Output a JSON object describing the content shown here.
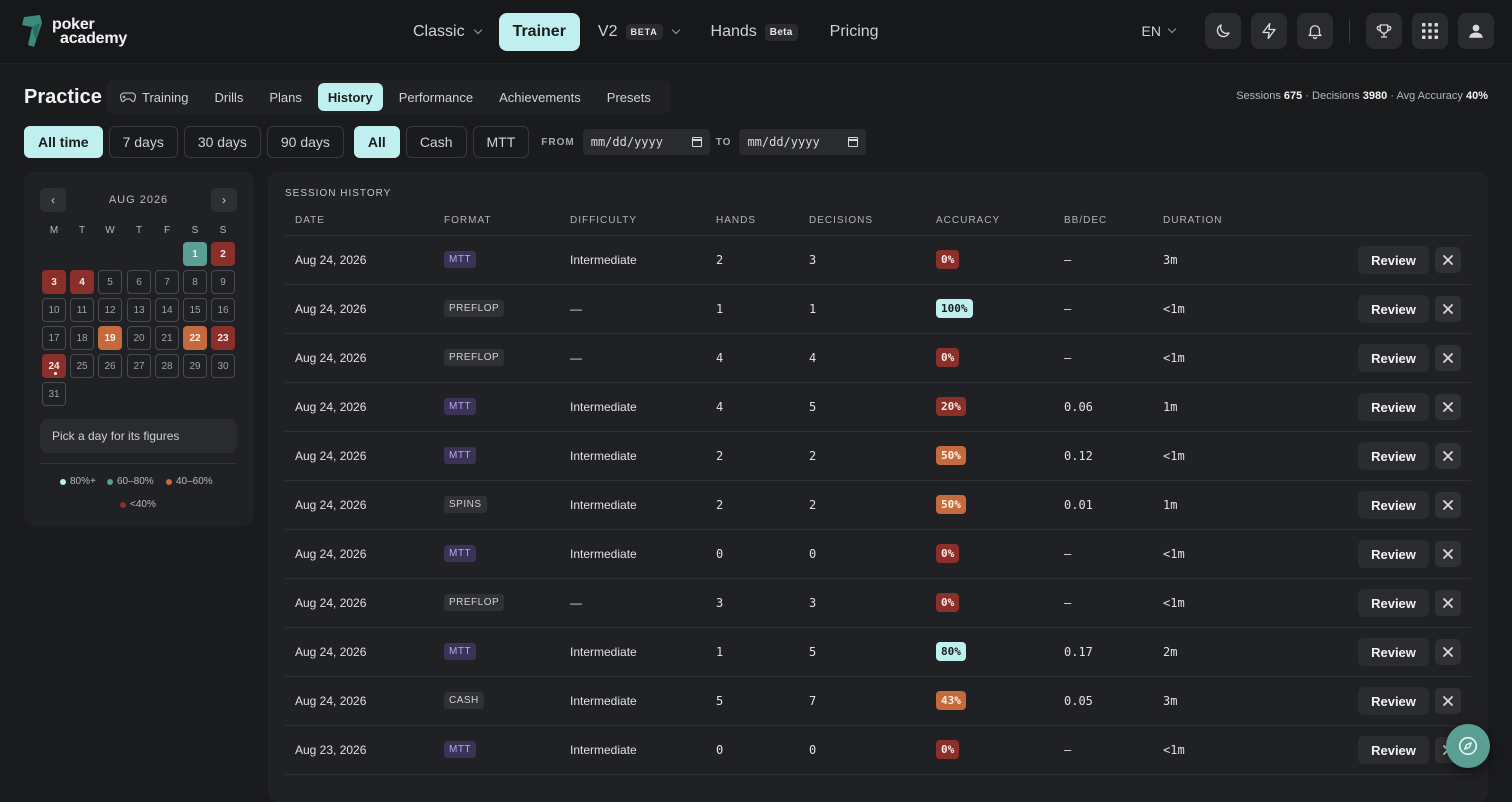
{
  "brand": {
    "line1": "poker",
    "line2": "academy"
  },
  "nav": {
    "classic": "Classic",
    "trainer": "Trainer",
    "v2": "V2",
    "v2_tag": "BETA",
    "hands": "Hands",
    "hands_tag": "Beta",
    "pricing": "Pricing"
  },
  "header_right": {
    "lang": "EN",
    "icons": [
      "moon-icon",
      "lightning-icon",
      "bell-icon",
      "trophy-icon",
      "grid-icon",
      "user-icon"
    ]
  },
  "practice": {
    "title": "Practice",
    "tabs": [
      "Training",
      "Drills",
      "Plans",
      "History",
      "Performance",
      "Achievements",
      "Presets"
    ],
    "active_tab": "History"
  },
  "stats": {
    "sessions_label": "Sessions",
    "sessions_value": "675",
    "decisions_label": "· Decisions",
    "decisions_value": "3980",
    "accuracy_label": "· Avg Accuracy",
    "accuracy_value": "40%"
  },
  "filters": {
    "ranges": [
      "All time",
      "7 days",
      "30 days",
      "90 days"
    ],
    "active_range": "All time",
    "formats": [
      "All",
      "Cash",
      "MTT"
    ],
    "active_format": "All",
    "from_label": "FROM",
    "to_label": "TO",
    "from_placeholder": "mm/dd/yyyy",
    "to_placeholder": "mm/dd/yyyy"
  },
  "calendar": {
    "month": "AUG 2026",
    "prev": "‹",
    "next": "›",
    "weekdays": [
      "M",
      "T",
      "W",
      "T",
      "F",
      "S",
      "S"
    ],
    "days": [
      {
        "d": "1",
        "s": "green"
      },
      {
        "d": "2",
        "s": "red"
      },
      {
        "d": "3",
        "s": "red"
      },
      {
        "d": "4",
        "s": "red"
      },
      {
        "d": "5",
        "s": ""
      },
      {
        "d": "6",
        "s": ""
      },
      {
        "d": "7",
        "s": ""
      },
      {
        "d": "8",
        "s": ""
      },
      {
        "d": "9",
        "s": ""
      },
      {
        "d": "10",
        "s": ""
      },
      {
        "d": "11",
        "s": ""
      },
      {
        "d": "12",
        "s": ""
      },
      {
        "d": "13",
        "s": ""
      },
      {
        "d": "14",
        "s": ""
      },
      {
        "d": "15",
        "s": ""
      },
      {
        "d": "16",
        "s": ""
      },
      {
        "d": "17",
        "s": ""
      },
      {
        "d": "18",
        "s": ""
      },
      {
        "d": "19",
        "s": "orange"
      },
      {
        "d": "20",
        "s": ""
      },
      {
        "d": "21",
        "s": ""
      },
      {
        "d": "22",
        "s": "orange"
      },
      {
        "d": "23",
        "s": "red"
      },
      {
        "d": "24",
        "s": "red"
      },
      {
        "d": "25",
        "s": ""
      },
      {
        "d": "26",
        "s": ""
      },
      {
        "d": "27",
        "s": ""
      },
      {
        "d": "28",
        "s": ""
      },
      {
        "d": "29",
        "s": ""
      },
      {
        "d": "30",
        "s": ""
      },
      {
        "d": "31",
        "s": ""
      }
    ],
    "today": "24",
    "pick_hint": "Pick a day for its figures",
    "legend": [
      {
        "label": "80%+",
        "color": "#bff0ef"
      },
      {
        "label": "60–80%",
        "color": "#5a9e94"
      },
      {
        "label": "40–60%",
        "color": "#c46a3c"
      },
      {
        "label": "<40%",
        "color": "#8a2f2a"
      }
    ]
  },
  "history": {
    "title": "SESSION HISTORY",
    "columns": [
      "DATE",
      "FORMAT",
      "DIFFICULTY",
      "HANDS",
      "DECISIONS",
      "ACCURACY",
      "BB/DEC",
      "DURATION"
    ],
    "review_label": "Review",
    "rows": [
      {
        "date": "Aug 24, 2026",
        "format": "MTT",
        "difficulty": "Intermediate",
        "hands": "2",
        "decisions": "3",
        "accuracy": "0%",
        "acc_level": "red",
        "bbdec": "—",
        "duration": "3m"
      },
      {
        "date": "Aug 24, 2026",
        "format": "PREFLOP",
        "difficulty": "—",
        "hands": "1",
        "decisions": "1",
        "accuracy": "100%",
        "acc_level": "green",
        "bbdec": "—",
        "duration": "<1m"
      },
      {
        "date": "Aug 24, 2026",
        "format": "PREFLOP",
        "difficulty": "—",
        "hands": "4",
        "decisions": "4",
        "accuracy": "0%",
        "acc_level": "red",
        "bbdec": "—",
        "duration": "<1m"
      },
      {
        "date": "Aug 24, 2026",
        "format": "MTT",
        "difficulty": "Intermediate",
        "hands": "4",
        "decisions": "5",
        "accuracy": "20%",
        "acc_level": "red",
        "bbdec": "0.06",
        "duration": "1m"
      },
      {
        "date": "Aug 24, 2026",
        "format": "MTT",
        "difficulty": "Intermediate",
        "hands": "2",
        "decisions": "2",
        "accuracy": "50%",
        "acc_level": "orange",
        "bbdec": "0.12",
        "duration": "<1m"
      },
      {
        "date": "Aug 24, 2026",
        "format": "SPINS",
        "difficulty": "Intermediate",
        "hands": "2",
        "decisions": "2",
        "accuracy": "50%",
        "acc_level": "orange",
        "bbdec": "0.01",
        "duration": "1m"
      },
      {
        "date": "Aug 24, 2026",
        "format": "MTT",
        "difficulty": "Intermediate",
        "hands": "0",
        "decisions": "0",
        "accuracy": "0%",
        "acc_level": "red",
        "bbdec": "—",
        "duration": "<1m"
      },
      {
        "date": "Aug 24, 2026",
        "format": "PREFLOP",
        "difficulty": "—",
        "hands": "3",
        "decisions": "3",
        "accuracy": "0%",
        "acc_level": "red",
        "bbdec": "—",
        "duration": "<1m"
      },
      {
        "date": "Aug 24, 2026",
        "format": "MTT",
        "difficulty": "Intermediate",
        "hands": "1",
        "decisions": "5",
        "accuracy": "80%",
        "acc_level": "green",
        "bbdec": "0.17",
        "duration": "2m"
      },
      {
        "date": "Aug 24, 2026",
        "format": "CASH",
        "difficulty": "Intermediate",
        "hands": "5",
        "decisions": "7",
        "accuracy": "43%",
        "acc_level": "orange",
        "bbdec": "0.05",
        "duration": "3m"
      },
      {
        "date": "Aug 23, 2026",
        "format": "MTT",
        "difficulty": "Intermediate",
        "hands": "0",
        "decisions": "0",
        "accuracy": "0%",
        "acc_level": "red",
        "bbdec": "—",
        "duration": "<1m"
      }
    ]
  },
  "colors": {
    "accent": "#bff0ef",
    "red": "#8a2f2a",
    "orange": "#c46a3c",
    "teal": "#5a9e94"
  }
}
